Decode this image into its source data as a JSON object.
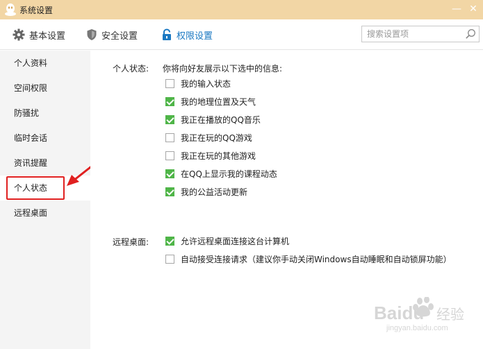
{
  "window": {
    "title": "系统设置",
    "minimize_symbol": "—",
    "close_symbol": "✕"
  },
  "toolbar": {
    "tabs": [
      {
        "label": "基本设置",
        "icon": "gear-icon"
      },
      {
        "label": "安全设置",
        "icon": "shield-icon"
      },
      {
        "label": "权限设置",
        "icon": "lock-icon",
        "active": true
      }
    ],
    "search_placeholder": "搜索设置项"
  },
  "sidebar": {
    "items": [
      {
        "label": "个人资料"
      },
      {
        "label": "空间权限"
      },
      {
        "label": "防骚扰"
      },
      {
        "label": "临时会话"
      },
      {
        "label": "资讯提醒"
      },
      {
        "label": "个人状态",
        "active": true
      },
      {
        "label": "远程桌面"
      }
    ]
  },
  "personal_status": {
    "label": "个人状态:",
    "description": "你将向好友展示以下选中的信息:",
    "options": [
      {
        "label": "我的输入状态",
        "checked": false
      },
      {
        "label": "我的地理位置及天气",
        "checked": true
      },
      {
        "label": "我正在播放的QQ音乐",
        "checked": true
      },
      {
        "label": "我正在玩的QQ游戏",
        "checked": false
      },
      {
        "label": "我正在玩的其他游戏",
        "checked": false
      },
      {
        "label": "在QQ上显示我的课程动态",
        "checked": true
      },
      {
        "label": "我的公益活动更新",
        "checked": true
      }
    ]
  },
  "remote_desktop": {
    "label": "远程桌面:",
    "options": [
      {
        "label": "允许远程桌面连接这台计算机",
        "checked": true
      },
      {
        "label": "自动接受连接请求（建议你手动关闭Windows自动睡眠和自动锁屏功能）",
        "checked": false
      }
    ]
  },
  "colors": {
    "titlebar": "#f2d6a5",
    "active_tab": "#1a78c2",
    "checkbox_checked": "#4fb548",
    "annotation_red": "#e02020",
    "sidebar_bg": "#f4f4f4"
  },
  "watermark": {
    "logo": "Baidu",
    "text": "经验",
    "domain": "jingyan.baidu.com"
  }
}
